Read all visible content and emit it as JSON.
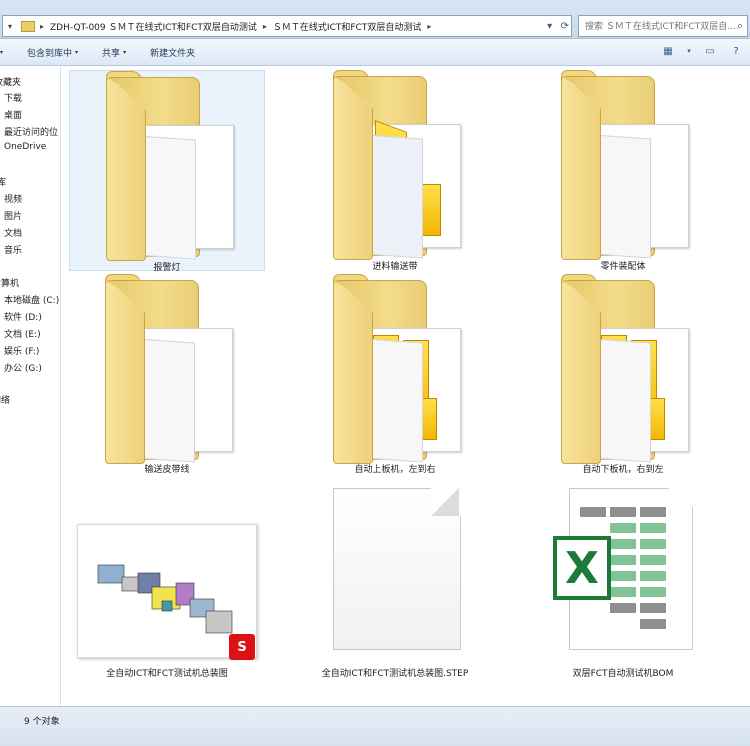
{
  "address": {
    "crumbs": [
      "ZDH-QT-009 ＳＭＴ在线式ICT和FCT双层自动测试",
      "ＳＭＴ在线式ICT和FCT双层自动测试"
    ],
    "search_placeholder": "搜索 ＳＭＴ在线式ICT和FCT双层自..."
  },
  "toolbar": {
    "include_label": "包含到库中",
    "share_label": "共享",
    "new_folder_label": "新建文件夹"
  },
  "nav": {
    "favorites": "收藏夹",
    "favorites_items": [
      "下载",
      "桌面",
      "最近访问的位",
      "OneDrive"
    ],
    "libraries": "库",
    "library_items": [
      "视频",
      "图片",
      "文档",
      "音乐"
    ],
    "computer": "计算机",
    "computer_items": [
      "本地磁盘 (C:)",
      "软件 (D:)",
      "文档 (E:)",
      "娱乐 (F:)",
      "办公 (G:)"
    ],
    "network": "网络"
  },
  "files": [
    {
      "name": "报警灯",
      "type": "folder",
      "selected": true
    },
    {
      "name": "进料输送带",
      "type": "folder"
    },
    {
      "name": "零件装配体",
      "type": "folder"
    },
    {
      "name": "输送皮带线",
      "type": "folder"
    },
    {
      "name": "自动上板机，左到右",
      "type": "folder"
    },
    {
      "name": "自动下板机，右到左",
      "type": "folder"
    },
    {
      "name": "全自动ICT和FCT测试机总装图",
      "type": "solidworks-assembly"
    },
    {
      "name": "全自动ICT和FCT测试机总装图.STEP",
      "type": "step-file"
    },
    {
      "name": "双层FCT自动测试机BOM",
      "type": "excel-file"
    }
  ],
  "status": {
    "count_text": "9 个对象"
  },
  "colors": {
    "folder": "#f3dc8a",
    "excel_green": "#1d7a3a",
    "solidworks_red": "#dd1111"
  }
}
